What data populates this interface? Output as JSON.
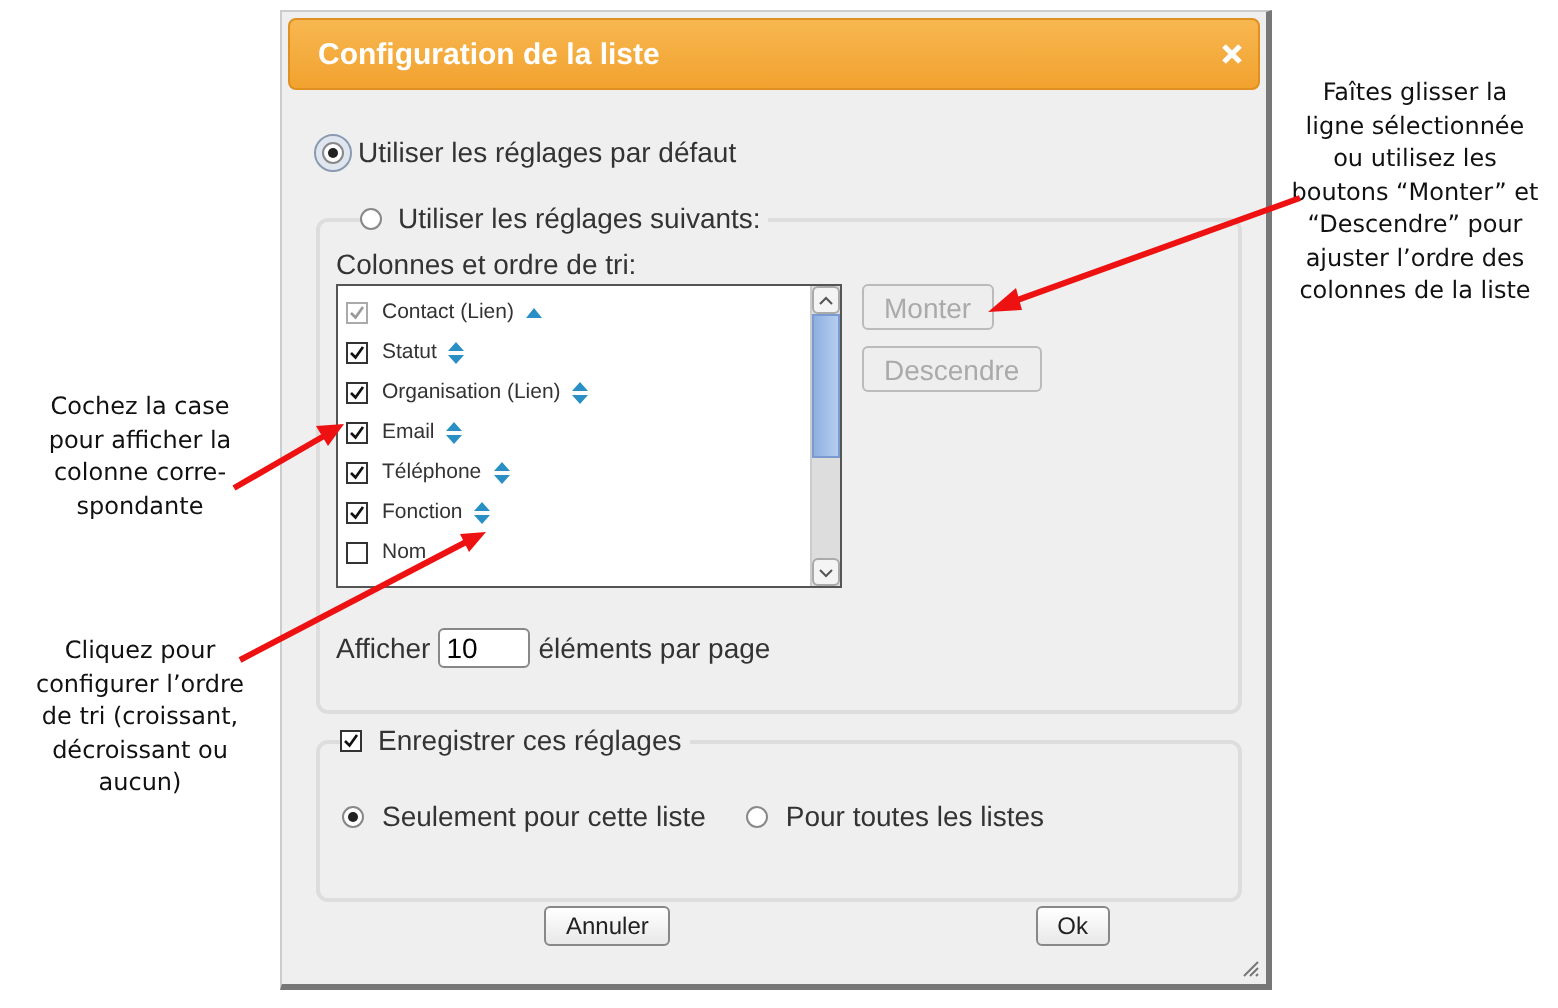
{
  "notes": {
    "left": [
      "Cochez la case pour afficher la colonne corre-spondante",
      "Cliquez pour configurer l’ordre de tri (croissant, décroissant ou aucun)"
    ],
    "right": "Faîtes glisser la ligne sélectionnée ou utilisez les boutons “Monter” et “Descendre” pour ajuster l’ordre des colonnes de la liste"
  },
  "dialog": {
    "title": "Configuration de la liste",
    "default_option": {
      "label": "Utiliser les réglages par défaut",
      "selected": true
    },
    "custom_option": {
      "label": "Utiliser les réglages suivants:",
      "selected": false
    },
    "columns_label": "Colonnes et ordre de tri:",
    "columns": [
      {
        "label": "Contact (Lien)",
        "checked": true,
        "disabled": true,
        "kind": "ascending"
      },
      {
        "label": "Statut",
        "checked": true,
        "disabled": false,
        "kind": "sortable"
      },
      {
        "label": "Organisation (Lien)",
        "checked": true,
        "disabled": false,
        "kind": "sortable"
      },
      {
        "label": "Email",
        "checked": true,
        "disabled": false,
        "kind": "sortable"
      },
      {
        "label": "Téléphone",
        "checked": true,
        "disabled": false,
        "kind": "sortable"
      },
      {
        "label": "Fonction",
        "checked": true,
        "disabled": false,
        "kind": "sortable"
      },
      {
        "label": "Nom",
        "checked": false,
        "disabled": false,
        "kind": "hidden"
      }
    ],
    "move_buttons": [
      {
        "label": "Monter",
        "disabled": true
      },
      {
        "label": "Descendre",
        "disabled": true
      }
    ],
    "page_size": {
      "before": "Afficher",
      "value": "10",
      "after": "éléments par page"
    },
    "save": {
      "label": "Enregistrer ces réglages",
      "checked": true
    },
    "scope": [
      {
        "label": "Seulement pour cette liste",
        "selected": true
      },
      {
        "label": "Pour toutes les listes",
        "selected": false
      }
    ],
    "buttons": [
      "Annuler",
      "Ok"
    ]
  }
}
